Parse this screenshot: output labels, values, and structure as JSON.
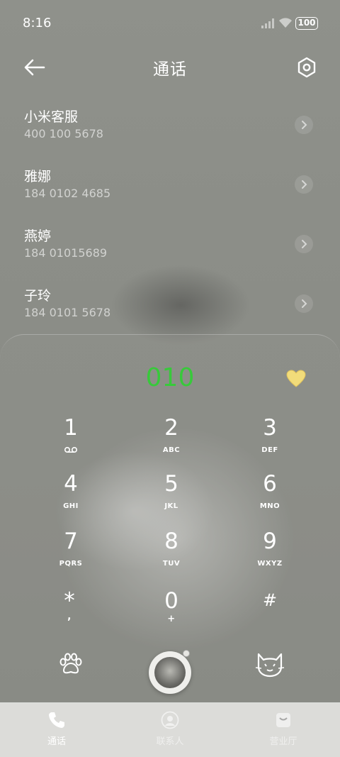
{
  "status_bar": {
    "time": "8:16",
    "battery": "100"
  },
  "header": {
    "title": "通话"
  },
  "recents": [
    {
      "name": "小米客服",
      "number": "400 100 5678"
    },
    {
      "name": "雅娜",
      "number": "184 0102 4685"
    },
    {
      "name": "燕婷",
      "number": "184 01015689"
    },
    {
      "name": "子玲",
      "number": "184 0101 5678"
    }
  ],
  "dialer": {
    "input": "010",
    "keys": [
      {
        "digit": "1",
        "letters": ""
      },
      {
        "digit": "2",
        "letters": "ABC"
      },
      {
        "digit": "3",
        "letters": "DEF"
      },
      {
        "digit": "4",
        "letters": "GHI"
      },
      {
        "digit": "5",
        "letters": "JKL"
      },
      {
        "digit": "6",
        "letters": "MNO"
      },
      {
        "digit": "7",
        "letters": "PQRS"
      },
      {
        "digit": "8",
        "letters": "TUV"
      },
      {
        "digit": "9",
        "letters": "WXYZ"
      },
      {
        "digit": "*",
        "letters": ","
      },
      {
        "digit": "0",
        "letters": "+"
      },
      {
        "digit": "#",
        "letters": ""
      }
    ]
  },
  "tabs": [
    {
      "label": "通话",
      "icon": "phone-icon",
      "active": true
    },
    {
      "label": "联系人",
      "icon": "contacts-icon",
      "active": false
    },
    {
      "label": "营业厅",
      "icon": "store-icon",
      "active": false
    }
  ],
  "colors": {
    "accent_green": "#38c93b",
    "heart": "#f2dc7a"
  }
}
